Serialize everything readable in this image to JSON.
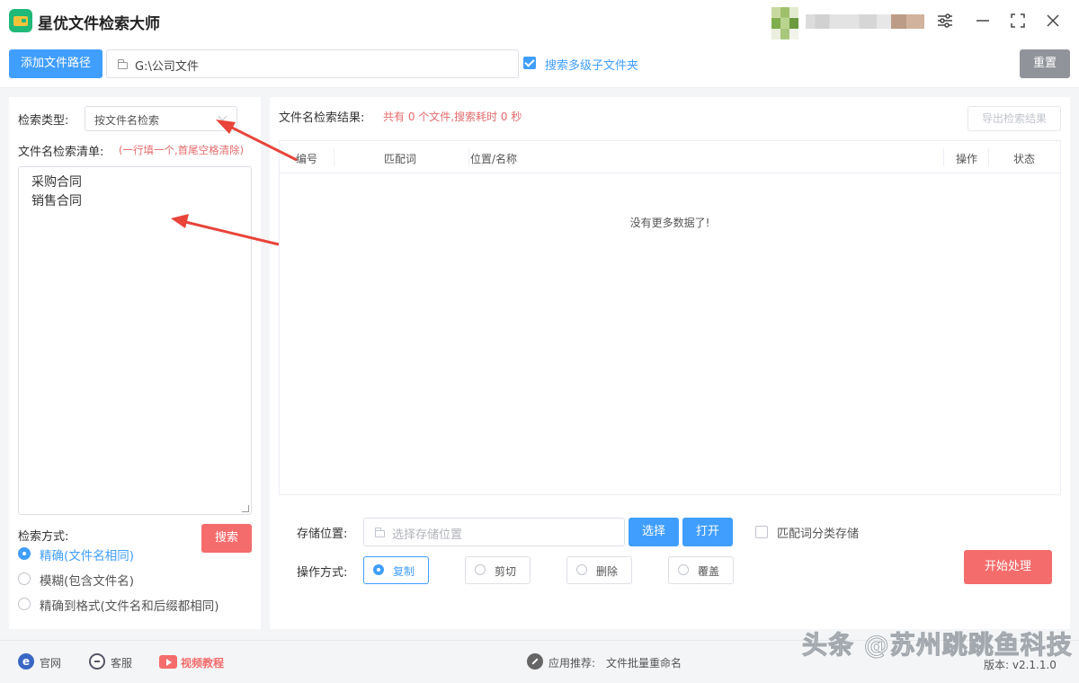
{
  "app": {
    "title": "星优文件检索大师",
    "window_controls": [
      "settings-icon",
      "minimize-icon",
      "maximize-icon",
      "close-icon"
    ]
  },
  "toolbar": {
    "add_path_label": "添加文件路径",
    "path_value": "G:\\公司文件",
    "search_subfolders_label": "搜索多级子文件夹",
    "search_subfolders_checked": true,
    "reset_label": "重置"
  },
  "left": {
    "search_type_label": "检索类型:",
    "search_type_value": "按文件名检索",
    "list_label": "文件名检索清单:",
    "list_hint": "(一行填一个,首尾空格清除)",
    "keywords": [
      "采购合同",
      "销售合同"
    ],
    "method_label": "检索方式:",
    "search_button": "搜索",
    "methods": [
      {
        "label": "精确(文件名相同)",
        "selected": true
      },
      {
        "label": "模糊(包含文件名)",
        "selected": false
      },
      {
        "label": "精确到格式(文件名和后缀都相同)",
        "selected": false
      }
    ]
  },
  "results": {
    "label": "文件名检索结果:",
    "summary": "共有 0 个文件,搜索耗时 0 秒",
    "export_button": "导出检索结果",
    "columns": [
      "编号",
      "匹配词",
      "位置/名称",
      "操作",
      "状态"
    ],
    "rows": [],
    "empty_text": "没有更多数据了!"
  },
  "storage": {
    "label": "存储位置:",
    "placeholder": "选择存储位置",
    "choose_button": "选择",
    "open_button": "打开",
    "classify_label": "匹配词分类存储",
    "classify_checked": false
  },
  "operation": {
    "label": "操作方式:",
    "options": [
      {
        "label": "复制",
        "selected": true
      },
      {
        "label": "剪切",
        "selected": false
      },
      {
        "label": "删除",
        "selected": false
      },
      {
        "label": "覆盖",
        "selected": false
      }
    ],
    "start_button": "开始处理"
  },
  "statusbar": {
    "website": "官网",
    "service": "客服",
    "video": "视频教程",
    "recommend_label": "应用推荐:",
    "recommend_app": "文件批量重命名",
    "version": "版本: v2.1.1.0"
  },
  "watermark": "头条 @苏州跳跳鱼科技",
  "colors": {
    "primary": "#409eff",
    "danger": "#f56c6c",
    "hint": "#e56a6a",
    "reset": "#909399",
    "arrow": "#e8443a"
  }
}
